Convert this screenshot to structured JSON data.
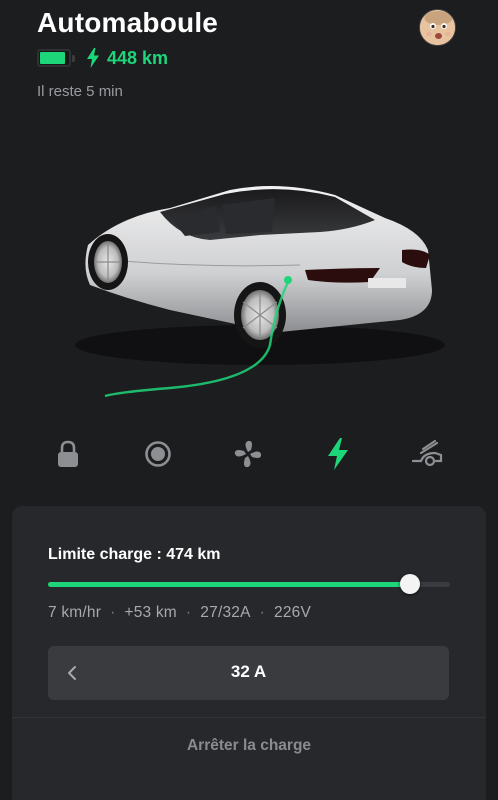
{
  "header": {
    "title": "Automaboule",
    "range": "448 km",
    "time_left": "Il reste 5 min",
    "battery_level": 0.9
  },
  "car_icons": [
    {
      "name": "lock-icon"
    },
    {
      "name": "climate-icon"
    },
    {
      "name": "fan-icon"
    },
    {
      "name": "charge-icon",
      "active": true
    },
    {
      "name": "trunk-icon"
    }
  ],
  "charge_panel": {
    "limit_label": "Limite charge : 474 km",
    "limit_fraction": 0.9,
    "stats": [
      "7 km/hr",
      "+53 km",
      "27/32A",
      "226V"
    ],
    "separator": "·",
    "amperage": "32 A",
    "stop_label": "Arrêter la charge"
  },
  "colors": {
    "accent": "#1ed67a",
    "background": "#1c1d1f",
    "panel": "#27282b"
  }
}
